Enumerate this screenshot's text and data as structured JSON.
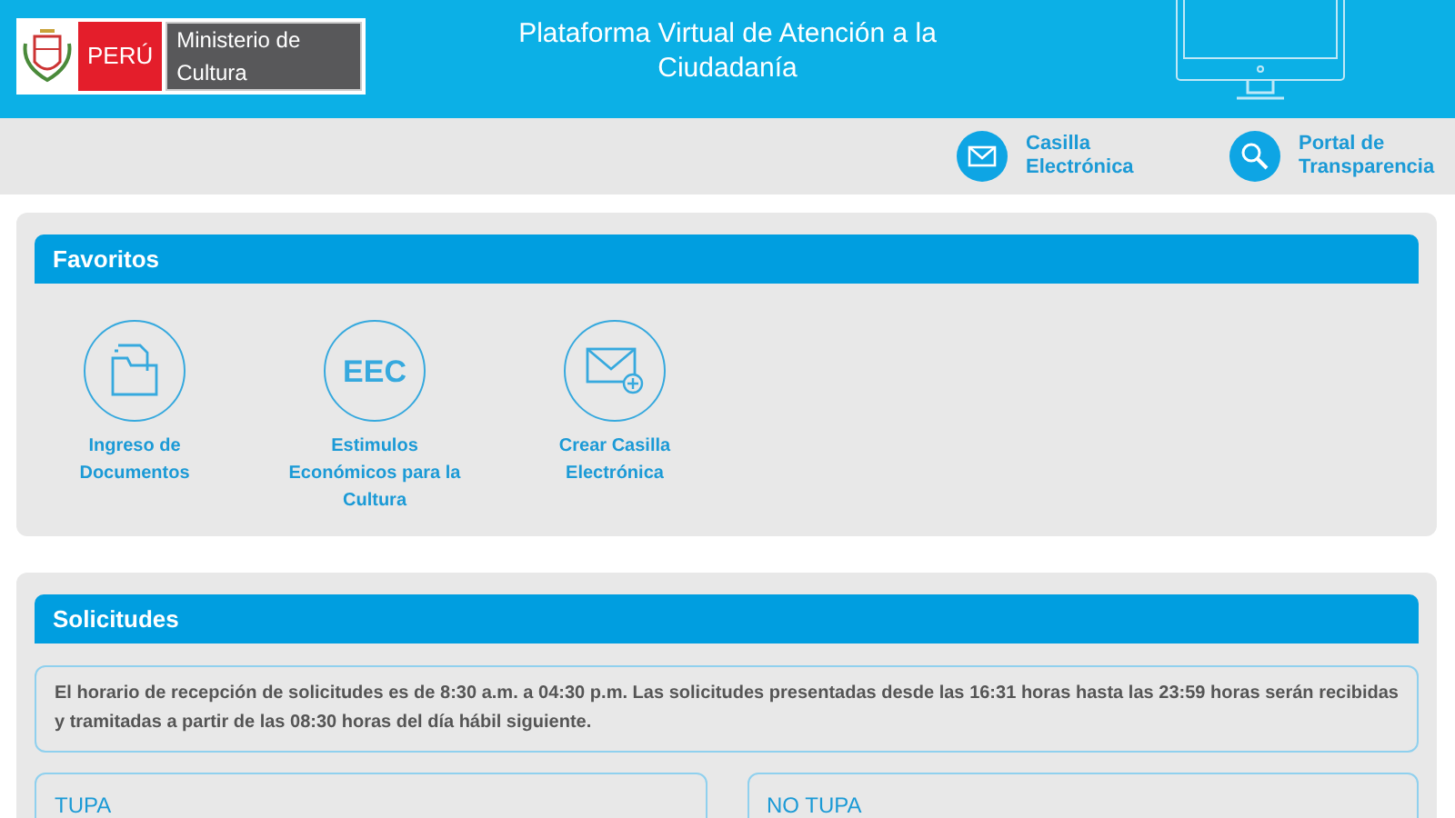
{
  "header": {
    "logo": {
      "country": "PERÚ",
      "ministry": "Ministerio de Cultura"
    },
    "title": "Plataforma Virtual de Atención a la Ciudadanía"
  },
  "top_links": [
    {
      "kind": "mail",
      "label": "Casilla Electrónica"
    },
    {
      "kind": "search",
      "label": "Portal de Transparencia"
    }
  ],
  "favoritos": {
    "title": "Favoritos",
    "items": [
      {
        "kind": "folder",
        "label": "Ingreso de Documentos"
      },
      {
        "kind": "eec",
        "icon_text": "EEC",
        "label": "Estimulos Económicos para la Cultura"
      },
      {
        "kind": "mail-plus",
        "label": "Crear Casilla Electrónica"
      }
    ]
  },
  "solicitudes": {
    "title": "Solicitudes",
    "notice": "El horario de recepción de solicitudes es de 8:30 a.m. a 04:30 p.m. Las solicitudes presentadas desde las 16:31 horas hasta las 23:59 horas serán recibidas y tramitadas a partir de las 08:30 horas del día hábil siguiente.",
    "groups": [
      {
        "title": "TUPA"
      },
      {
        "title": "NO TUPA"
      }
    ]
  }
}
